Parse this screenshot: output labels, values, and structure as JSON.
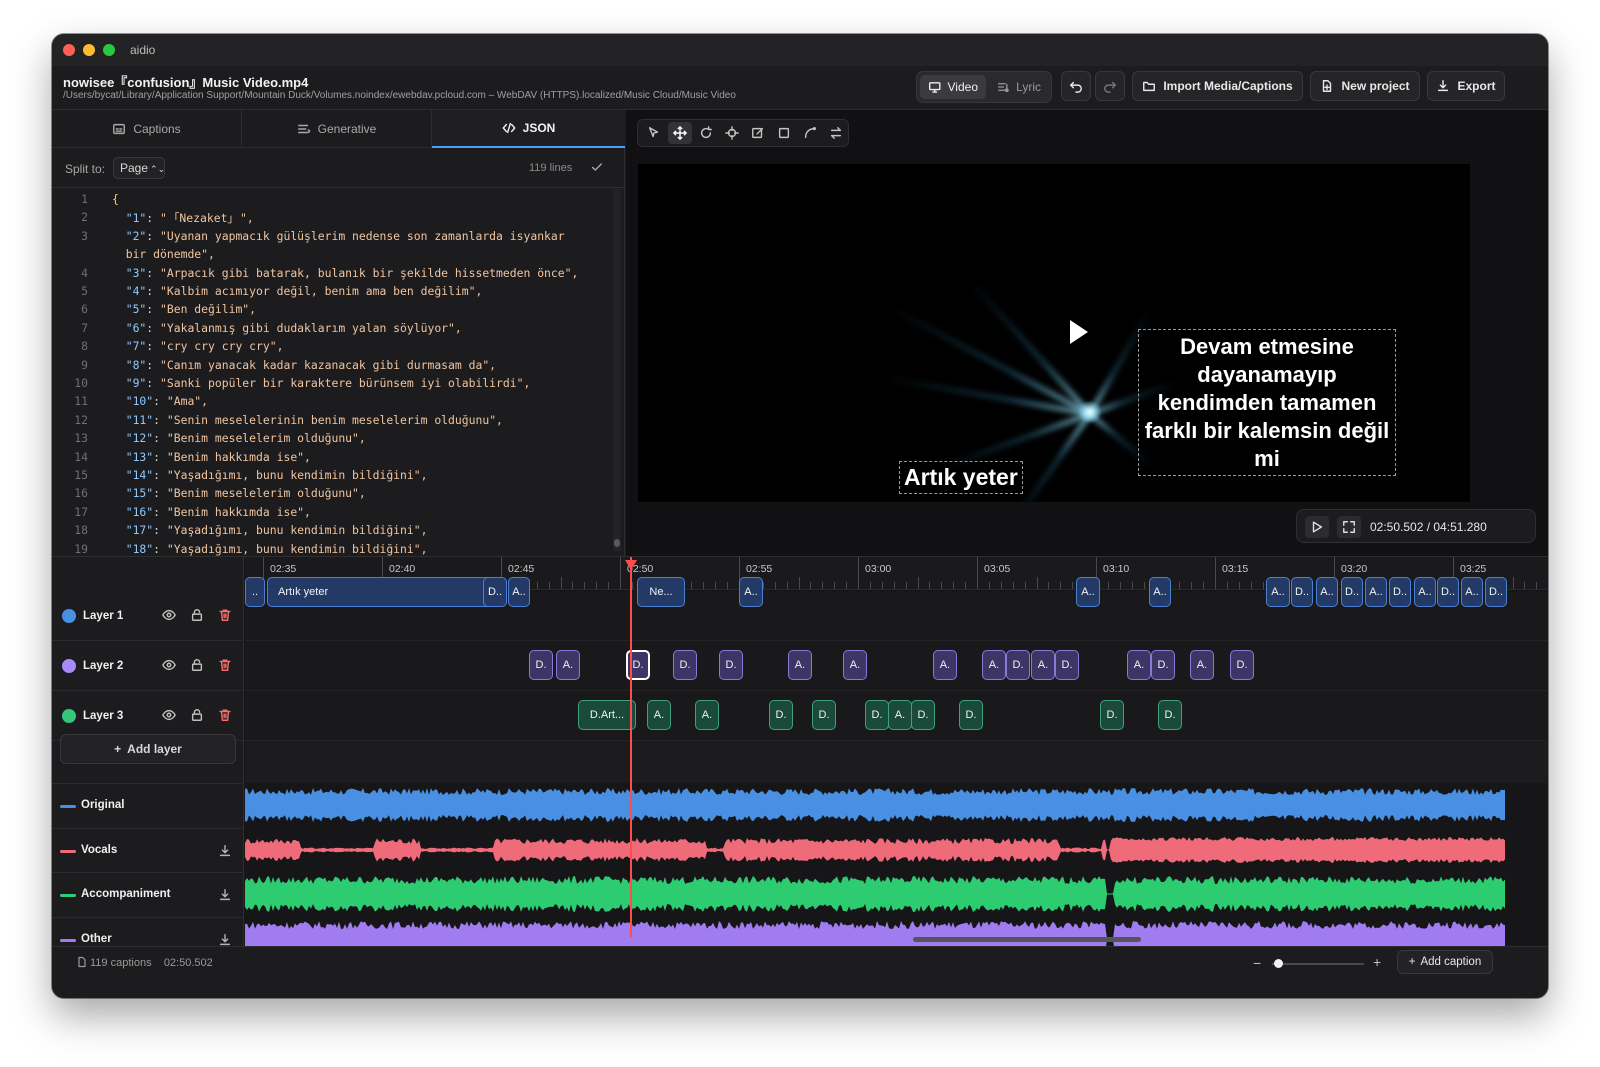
{
  "app": {
    "title": "aidio"
  },
  "header": {
    "file_name": "nowisee『confusion』Music Video.mp4",
    "file_path": "/Users/bycat/Library/Application Support/Mountain Duck/Volumes.noindex/ewebdav.pcloud.com – WebDAV (HTTPS).localized/Music Cloud/Music Video",
    "mode_video": "Video",
    "mode_lyric": "Lyric",
    "import_label": "Import Media/Captions",
    "new_project_label": "New project",
    "export_label": "Export"
  },
  "left_panel": {
    "tabs": [
      "Captions",
      "Generative",
      "JSON"
    ],
    "active_tab": "JSON",
    "split_label": "Split to:",
    "split_value": "Page",
    "lines_count": "119 lines",
    "code_lines": [
      {
        "n": "1",
        "k": "",
        "v": "{"
      },
      {
        "n": "2",
        "k": "\"1\"",
        "v": "\" ｢Nezaket｣ \","
      },
      {
        "n": "3",
        "k": "\"2\"",
        "v": "\"Uyanan yapmacık gülüşlerim nedense son zamanlarda isyankar"
      },
      {
        "n": "",
        "k": "",
        "v": "bir dönemde\","
      },
      {
        "n": "4",
        "k": "\"3\"",
        "v": "\"Arpacık gibi batarak, bulanık bir şekilde hissetmeden önce\","
      },
      {
        "n": "5",
        "k": "\"4\"",
        "v": "\"Kalbim acımıyor değil, benim ama ben değilim\","
      },
      {
        "n": "6",
        "k": "\"5\"",
        "v": "\"Ben değilim\","
      },
      {
        "n": "7",
        "k": "\"6\"",
        "v": "\"Yakalanmış gibi dudaklarım yalan söylüyor\","
      },
      {
        "n": "8",
        "k": "\"7\"",
        "v": "\"cry cry cry cry\","
      },
      {
        "n": "9",
        "k": "\"8\"",
        "v": "\"Canım yanacak kadar kazanacak gibi durmasam da\","
      },
      {
        "n": "10",
        "k": "\"9\"",
        "v": "\"Sanki popüler bir karaktere bürünsem iyi olabilirdi\","
      },
      {
        "n": "11",
        "k": "\"10\"",
        "v": "\"Ama\","
      },
      {
        "n": "12",
        "k": "\"11\"",
        "v": "\"Senin meselelerinin benim meselelerim olduğunu\","
      },
      {
        "n": "13",
        "k": "\"12\"",
        "v": "\"Benim meselelerim olduğunu\","
      },
      {
        "n": "14",
        "k": "\"13\"",
        "v": "\"Benim hakkımda ise\","
      },
      {
        "n": "15",
        "k": "\"14\"",
        "v": "\"Yaşadığımı, bunu kendimin bildiğini\","
      },
      {
        "n": "16",
        "k": "\"15\"",
        "v": "\"Benim meselelerim olduğunu\","
      },
      {
        "n": "17",
        "k": "\"16\"",
        "v": "\"Benim hakkımda ise\","
      },
      {
        "n": "18",
        "k": "\"17\"",
        "v": "\"Yaşadığımı, bunu kendimin bildiğini\","
      },
      {
        "n": "19",
        "k": "\"18\"",
        "v": "\"Yaşadığımı, bunu kendimin bildiğini\","
      }
    ]
  },
  "video": {
    "subtitle_bottom": "Artık yeter",
    "subtitle_right": "Devam etmesine dayanamayıp kendimden tamamen farklı bir kalemsin değil mi",
    "time_display": "02:50.502 / 04:51.280"
  },
  "timeline": {
    "ruler_labels": [
      "02:35",
      "02:40",
      "02:45",
      "02:50",
      "02:55",
      "03:00",
      "03:05",
      "03:10",
      "03:15",
      "03:20",
      "03:25"
    ],
    "layers": [
      {
        "name": "Layer 1",
        "color": "#4a90e2"
      },
      {
        "name": "Layer 2",
        "color": "#a78bfa"
      },
      {
        "name": "Layer 3",
        "color": "#34c77b"
      }
    ],
    "add_layer_label": "Add layer",
    "audio_tracks": [
      {
        "name": "Original",
        "color": "#4a90e2"
      },
      {
        "name": "Vocals",
        "color": "#f06b7a"
      },
      {
        "name": "Accompaniment",
        "color": "#2ecc71"
      },
      {
        "name": "Other",
        "color": "#a07cf0"
      }
    ],
    "layer1_clips": [
      "..",
      "Artık yeter",
      "D..",
      "A..",
      "Ne...",
      "A..",
      "A..",
      "A..",
      "A..",
      "D..",
      "A..",
      "D..",
      "A..",
      "D..",
      "A..",
      "D..",
      "A..",
      "D.."
    ],
    "layer2_clips": [
      "D.",
      "A.",
      "D.",
      "D.",
      "D.",
      "A.",
      "A.",
      "A.",
      "A.",
      "D.",
      "A.",
      "D.",
      "A.",
      "D.",
      "A.",
      "D."
    ],
    "layer3_clips": [
      "D.Art...",
      "A.",
      "A.",
      "D.",
      "D.",
      "D.",
      "A.",
      "D.",
      "D.",
      "D.",
      "D."
    ]
  },
  "status": {
    "captions_count": "119 captions",
    "current_time": "02:50.502",
    "add_caption_label": "Add caption"
  }
}
